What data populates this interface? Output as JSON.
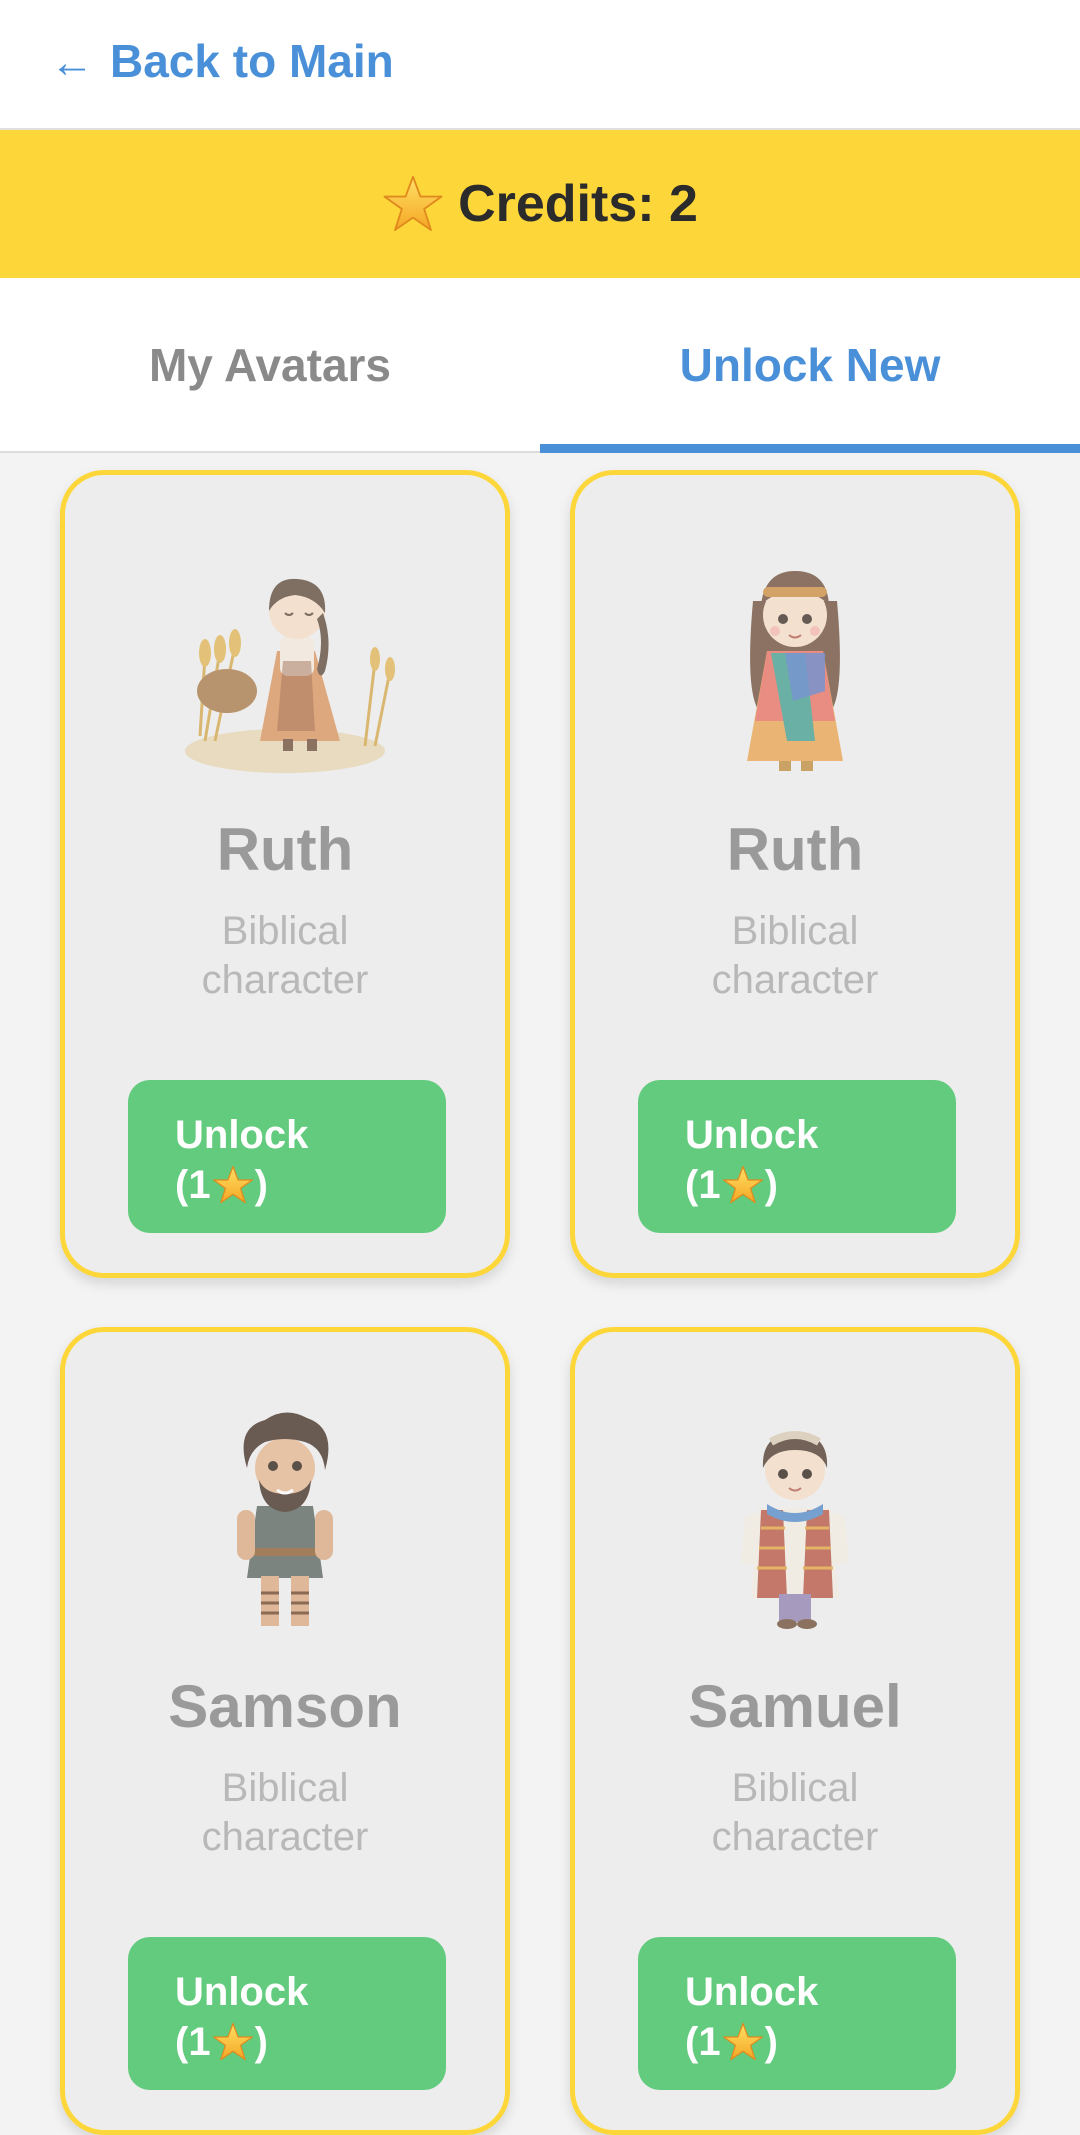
{
  "header": {
    "back_arrow": "←",
    "back_label": "Back to Main"
  },
  "credits": {
    "label": "Credits: 2",
    "icon": "star-icon"
  },
  "tabs": [
    {
      "label": "My Avatars",
      "active": false
    },
    {
      "label": "Unlock New",
      "active": true
    }
  ],
  "cards": [
    {
      "name": "Ruth",
      "desc_line1": "Biblical",
      "desc_line2": "character",
      "btn_line1": "Unlock",
      "btn_open": "(1",
      "btn_close": ")",
      "avatar": "ruth-wheat-avatar"
    },
    {
      "name": "Ruth",
      "desc_line1": "Biblical",
      "desc_line2": "character",
      "btn_line1": "Unlock",
      "btn_open": "(1",
      "btn_close": ")",
      "avatar": "ruth-scarf-avatar"
    },
    {
      "name": "Samson",
      "desc_line1": "Biblical",
      "desc_line2": "character",
      "btn_line1": "Unlock",
      "btn_open": "(1",
      "btn_close": ")",
      "avatar": "samson-avatar"
    },
    {
      "name": "Samuel",
      "desc_line1": "Biblical",
      "desc_line2": "character",
      "btn_line1": "Unlock",
      "btn_open": "(1",
      "btn_close": ")",
      "avatar": "samuel-avatar"
    }
  ],
  "colors": {
    "accent_blue": "#4a90d9",
    "credits_yellow": "#fdd73a",
    "unlock_green": "#62cb7e"
  }
}
